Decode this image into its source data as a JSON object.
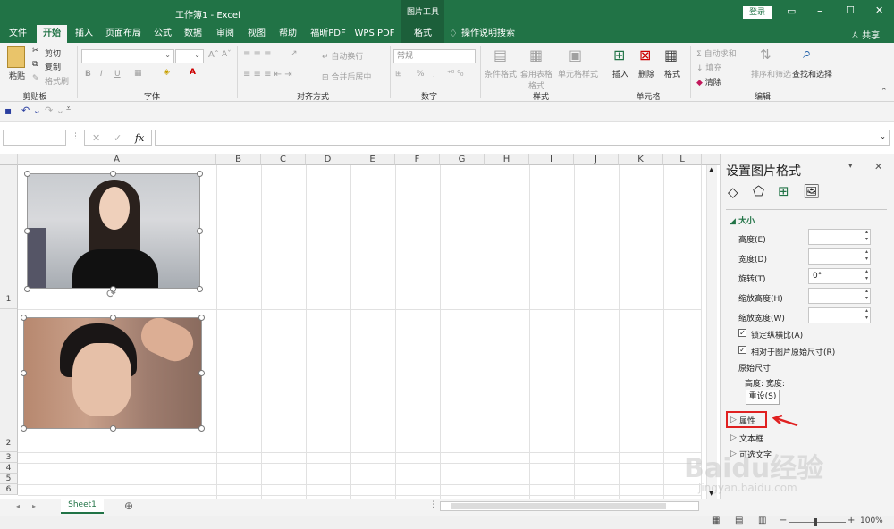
{
  "titlebar": {
    "title": "工作簿1 - Excel",
    "tool_context": "图片工具",
    "login": "登录",
    "share": "共享"
  },
  "tabs": [
    "文件",
    "开始",
    "插入",
    "页面布局",
    "公式",
    "数据",
    "审阅",
    "视图",
    "帮助",
    "福昕PDF",
    "WPS PDF",
    "格式"
  ],
  "tell_me": "操作说明搜索",
  "ribbon": {
    "clipboard": {
      "paste": "粘贴",
      "cut": "剪切",
      "copy": "复制",
      "format_painter": "格式刷",
      "label": "剪贴板"
    },
    "font": {
      "label": "字体",
      "bold": "B",
      "italic": "I",
      "underline": "U"
    },
    "align": {
      "wrap": "自动换行",
      "merge": "合并后居中",
      "label": "对齐方式"
    },
    "number": {
      "format": "常规",
      "percent": "%",
      "comma": ",",
      "label": "数字"
    },
    "styles": {
      "conditional": "条件格式",
      "table": "套用表格格式",
      "cell": "单元格样式",
      "label": "样式"
    },
    "cells": {
      "insert": "插入",
      "delete": "删除",
      "format": "格式",
      "label": "单元格"
    },
    "editing": {
      "autosum": "自动求和",
      "fill": "填充",
      "clear": "清除",
      "sort": "排序和筛选",
      "find": "查找和选择",
      "label": "编辑"
    }
  },
  "formula_bar": {
    "name_box": "",
    "fx": "fx",
    "cancel": "✕",
    "enter": "✓"
  },
  "grid": {
    "columns": [
      "A",
      "B",
      "C",
      "D",
      "E",
      "F",
      "G",
      "H",
      "I",
      "J",
      "K",
      "L"
    ],
    "rows": [
      "1",
      "2",
      "3",
      "4",
      "5",
      "6"
    ]
  },
  "pane": {
    "title": "设置图片格式",
    "section_size": "大小",
    "height_label": "高度(E)",
    "width_label": "宽度(D)",
    "rotate_label": "旋转(T)",
    "rotate_value": "0°",
    "scale_h_label": "缩放高度(H)",
    "scale_w_label": "缩放宽度(W)",
    "lock_aspect": "锁定纵横比(A)",
    "relative_orig": "相对于图片原始尺寸(R)",
    "original_size": "原始尺寸",
    "orig_hw": "高度:   宽度:",
    "reset": "重设(S)",
    "properties": "属性",
    "textbox": "文本框",
    "alt_text": "可选文字"
  },
  "status": {
    "sheet": "Sheet1",
    "zoom": "100%",
    "watermark": "Baidu经验",
    "watermark_url": "jingyan.baidu.com"
  },
  "colors": {
    "excel_green": "#217346",
    "highlight_red": "#e02020"
  }
}
